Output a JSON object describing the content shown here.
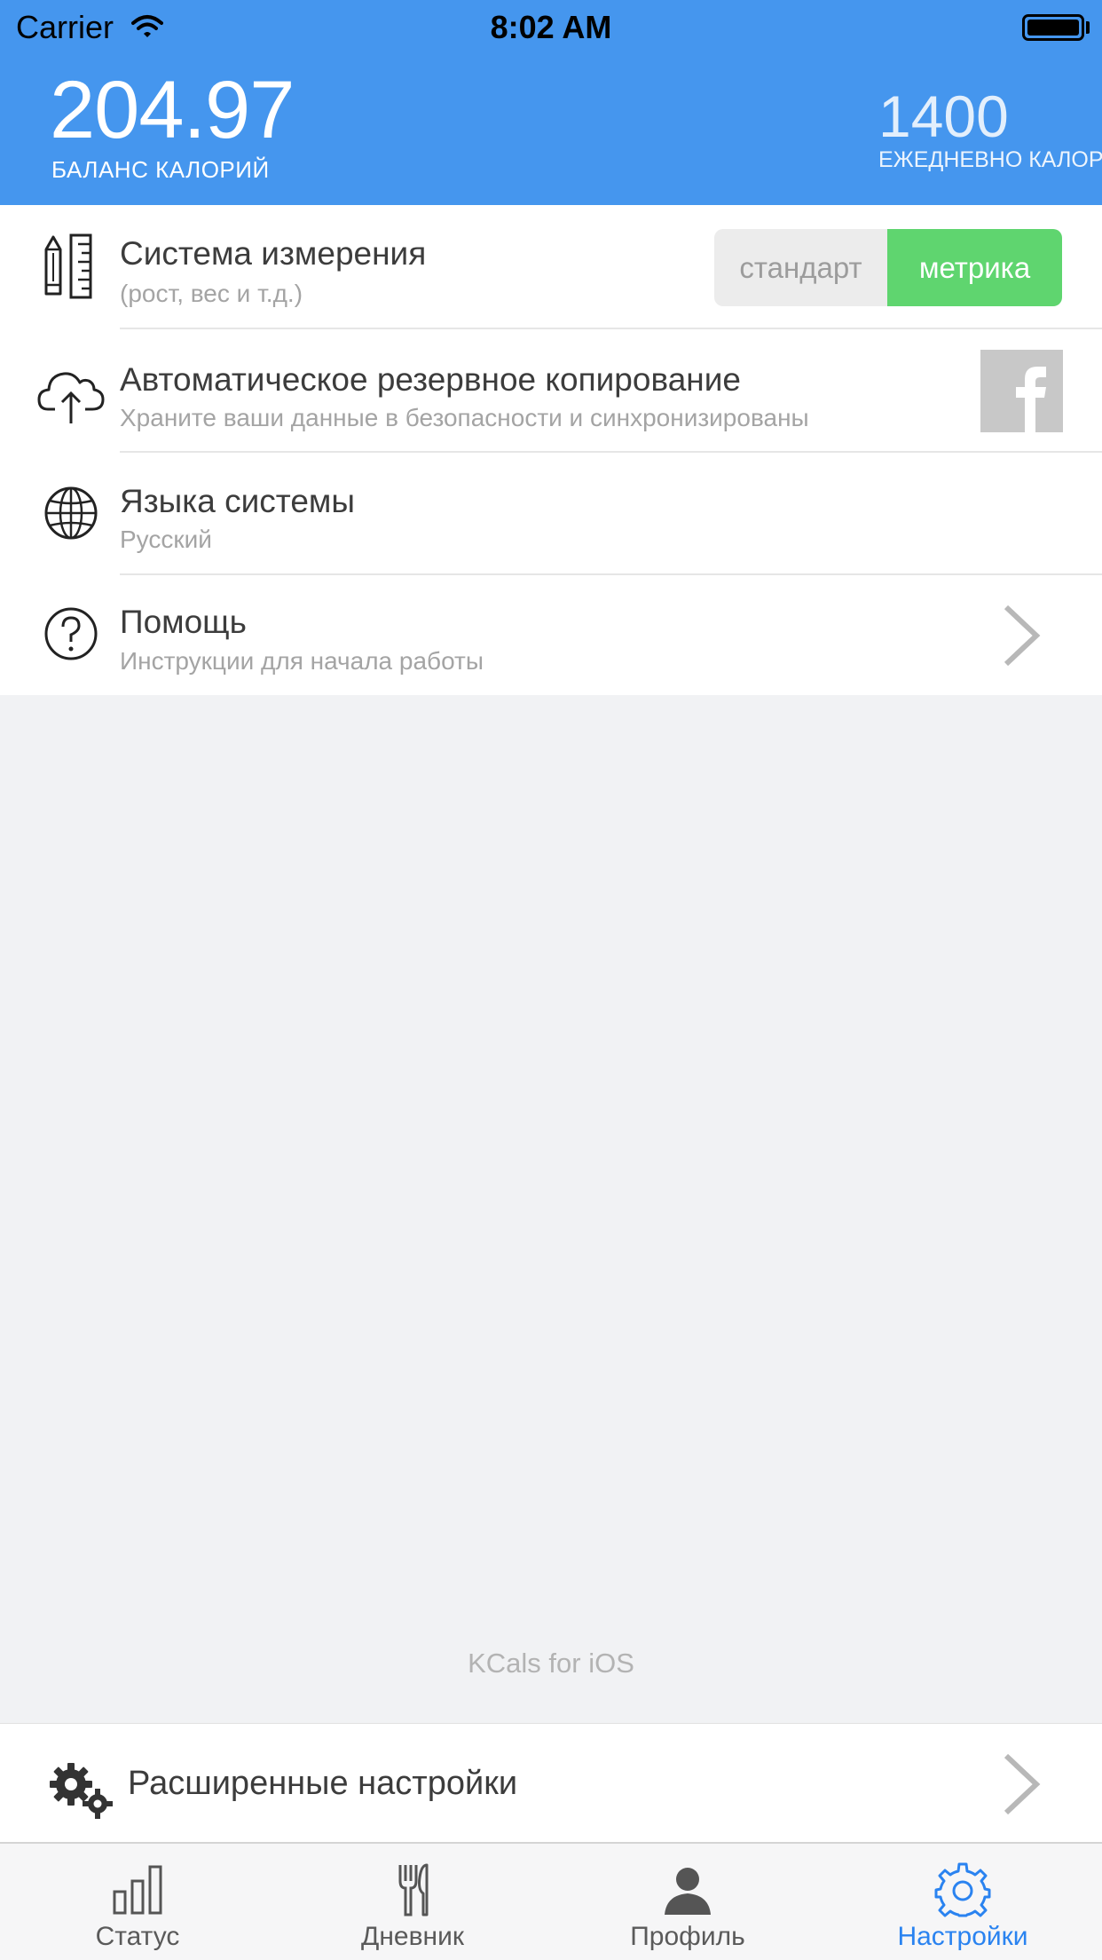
{
  "status_bar": {
    "carrier": "Carrier",
    "time": "8:02 AM"
  },
  "header": {
    "balance_value": "204.97",
    "balance_label": "БАЛАНС КАЛОРИЙ",
    "daily_value": "1400",
    "daily_label": "ЕЖЕДНЕВНО КАЛОРИЙ"
  },
  "settings": [
    {
      "title": "Система измерения",
      "subtitle": "(рост, вес и т.д.)",
      "icon": "ruler-pencil-icon",
      "segment": {
        "left": "стандарт",
        "right": "метрика",
        "selected": "метрика"
      }
    },
    {
      "title": "Автоматическое резервное копирование",
      "subtitle": "Храните ваши данные в безопасности и синхронизированы",
      "icon": "cloud-upload-icon",
      "accessory": "facebook-icon"
    },
    {
      "title": "Языка системы",
      "subtitle": "Русский",
      "icon": "globe-icon"
    },
    {
      "title": "Помощь",
      "subtitle": "Инструкции для начала работы",
      "icon": "help-icon",
      "accessory": "chevron-right-icon"
    }
  ],
  "footer_note": "KCals for iOS",
  "advanced": {
    "label": "Расширенные настройки",
    "icon": "gears-icon"
  },
  "tabs": [
    {
      "label": "Статус",
      "icon": "bar-chart-icon",
      "active": false
    },
    {
      "label": "Дневник",
      "icon": "fork-knife-icon",
      "active": false
    },
    {
      "label": "Профиль",
      "icon": "user-icon",
      "active": false
    },
    {
      "label": "Настройки",
      "icon": "gear-icon",
      "active": true
    }
  ],
  "colors": {
    "header_bg": "#4596ee",
    "accent_green": "#5fd56f",
    "active_tab": "#2a83f0",
    "background": "#f1f2f4"
  }
}
